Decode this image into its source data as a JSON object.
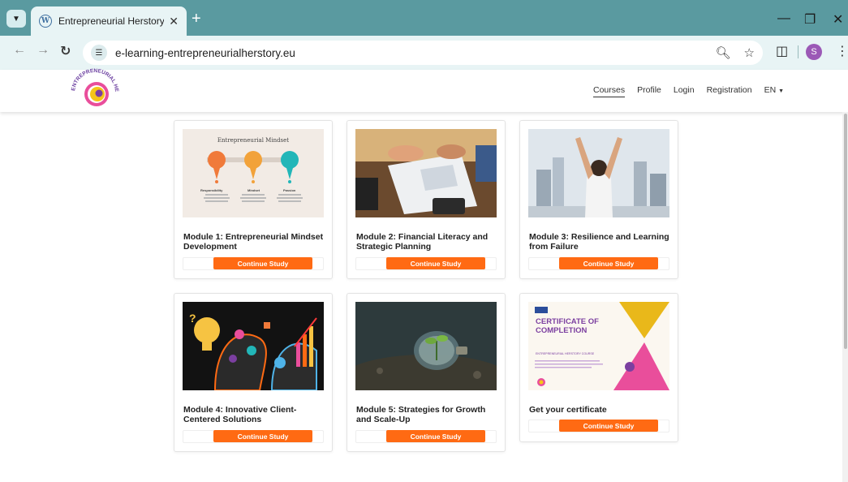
{
  "browser": {
    "tab_title": "Entrepreneurial Herstory",
    "tab_favicon": "W",
    "url": "e-learning-entrepreneurialherstory.eu",
    "profile_initial": "S"
  },
  "logo": {
    "text": "ENTREPRENEURIAL HERSTORY",
    "colors": [
      "#e94e9b",
      "#f5c518",
      "#7b3fa0"
    ]
  },
  "nav": {
    "items": [
      "Courses",
      "Profile",
      "Login",
      "Registration",
      "EN"
    ],
    "active": "Courses"
  },
  "cards": [
    {
      "title": "Module 1: Entrepreneurial Mindset Development",
      "button": "Continue Study"
    },
    {
      "title": "Module 2: Financial Literacy and Strategic Planning",
      "button": "Continue Study"
    },
    {
      "title": "Module 3: Resilience and Learning from Failure",
      "button": "Continue Study"
    },
    {
      "title": "Module 4: Innovative Client-Centered Solutions",
      "button": "Continue Study"
    },
    {
      "title": "Module 5: Strategies for Growth and Scale-Up",
      "button": "Continue Study"
    },
    {
      "title": "Get your certificate",
      "button": "Continue Study"
    }
  ],
  "card1_image": {
    "heading": "Entrepreneurial Mindset",
    "labels": [
      "Responsibility",
      "Mindset",
      "Passion"
    ]
  },
  "certificate_image": {
    "line1": "CERTIFICATE OF",
    "line2": "COMPLETION",
    "course": "ENTREPRENEURIAL HERSTORY COURSE"
  },
  "colors": {
    "accent_button": "#ff6a13",
    "chrome_tabbar": "#5a9aa0",
    "chrome_toolbar": "#e8f4f5"
  }
}
